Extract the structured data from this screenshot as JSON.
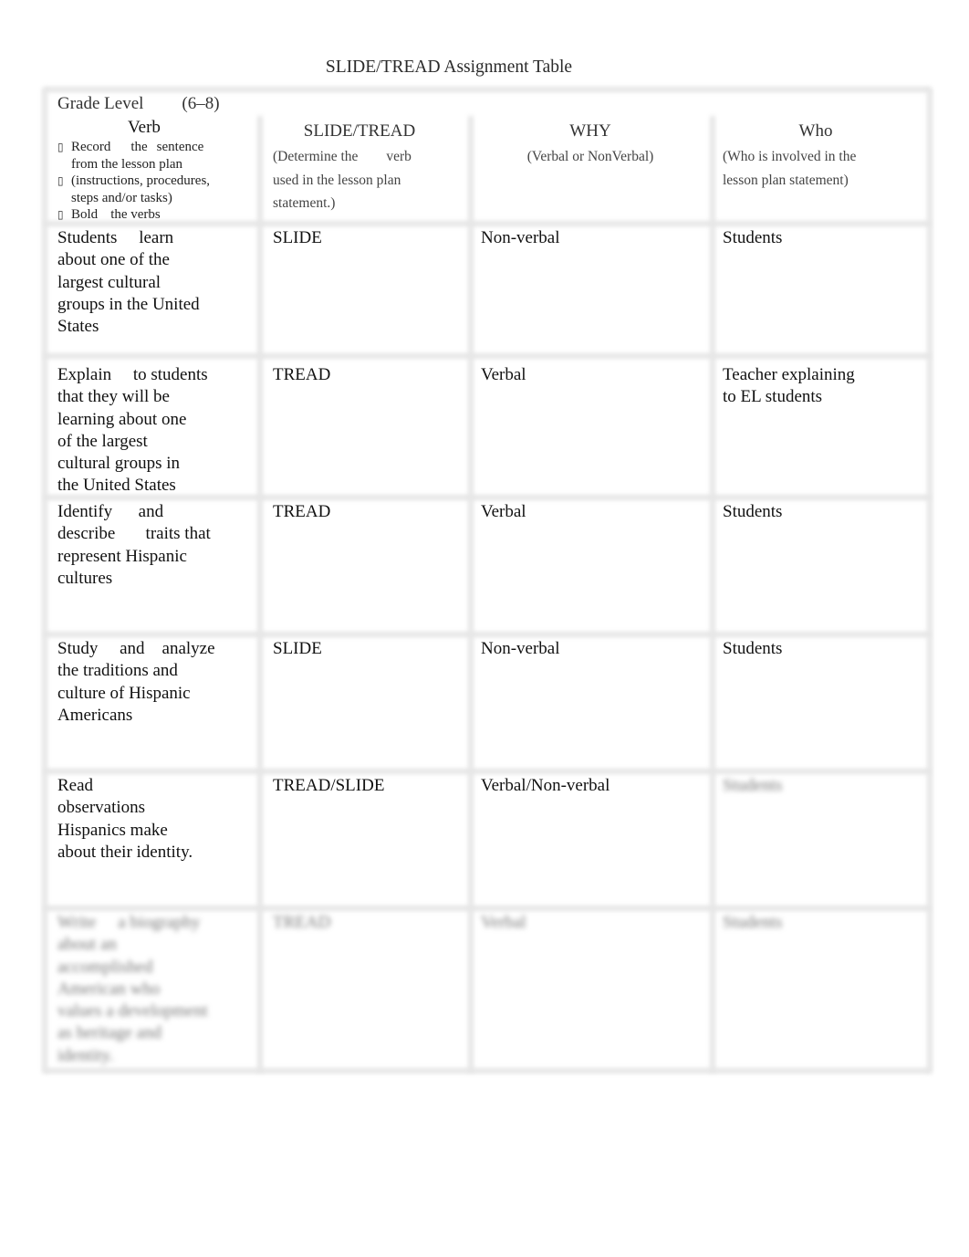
{
  "document": {
    "title": "SLIDE/TREAD Assignment Table"
  },
  "table": {
    "grade_level_label": "Grade Level",
    "grade_level_value": "(6–8)",
    "headers": {
      "verb": {
        "title": "Verb",
        "instructions": [
          {
            "bullet": "bullet-icon",
            "text_parts": [
              "Record",
              "the",
              "sentence"
            ],
            "continuation": "from the lesson plan"
          },
          {
            "bullet": "bullet-icon",
            "text": "(instructions, procedures,",
            "continuation": "steps and/or tasks)"
          },
          {
            "bullet": "bullet-icon",
            "text_parts": [
              "Bold",
              "the verbs"
            ]
          }
        ]
      },
      "slide_tread": {
        "title": "SLIDE/TREAD",
        "subtitle_lines": [
          "(Determine the        verb",
          "used in the lesson plan",
          "statement.)"
        ]
      },
      "why": {
        "title": "WHY",
        "subtitle": "(Verbal or NonVerbal)"
      },
      "who": {
        "title": "Who",
        "subtitle_lines": [
          "(Who is involved in the",
          "lesson plan statement)"
        ]
      }
    },
    "rows": [
      {
        "verb_lines": [
          "Students     learn",
          "about one of the",
          "largest cultural",
          "groups in the United",
          "States"
        ],
        "slide_tread": "SLIDE",
        "why": "Non-verbal",
        "who_lines": [
          "Students"
        ],
        "obscured": false
      },
      {
        "verb_lines": [
          "Explain     to students",
          "that they will be",
          "learning about one",
          "of the largest",
          "cultural groups in",
          "the United States"
        ],
        "slide_tread": "TREAD",
        "why": "Verbal",
        "who_lines": [
          "Teacher explaining",
          "to EL students"
        ],
        "obscured": false
      },
      {
        "verb_lines": [
          "Identify      and",
          "describe       traits that",
          "represent Hispanic",
          "cultures"
        ],
        "slide_tread": "TREAD",
        "why": "Verbal",
        "who_lines": [
          "Students"
        ],
        "obscured": false
      },
      {
        "verb_lines": [
          "Study     and    analyze",
          "the traditions and",
          "culture of Hispanic",
          "Americans"
        ],
        "slide_tread": "SLIDE",
        "why": "Non-verbal",
        "who_lines": [
          "Students"
        ],
        "obscured": false
      },
      {
        "verb_lines": [
          "Read",
          "observations",
          "Hispanics make",
          "about their identity."
        ],
        "slide_tread": "TREAD/SLIDE",
        "why": "Verbal/Non-verbal",
        "who_lines": [
          "Students"
        ],
        "who_obscured": true,
        "obscured": false
      },
      {
        "verb_lines": [
          "Write     a biography",
          "about an",
          "accomplished",
          "American who",
          "values a development",
          "as heritage and",
          "identity."
        ],
        "slide_tread": "TREAD",
        "why": "Verbal",
        "who_lines": [
          "Students"
        ],
        "obscured": true
      }
    ]
  }
}
